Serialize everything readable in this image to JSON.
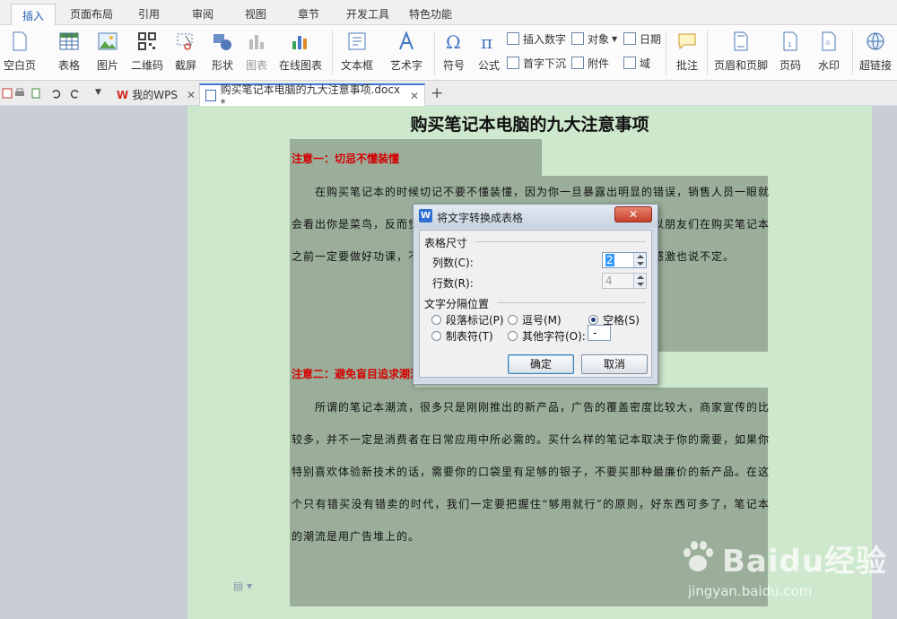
{
  "menu": {
    "tabs": [
      "插入",
      "页面布局",
      "引用",
      "审阅",
      "视图",
      "章节",
      "开发工具",
      "特色功能"
    ],
    "active": "插入"
  },
  "ribbon": {
    "blank_page": "空白页",
    "table": "表格",
    "image": "图片",
    "qrcode": "二维码",
    "screenshot": "截屏",
    "shape": "形状",
    "chart": "图表",
    "online_chart": "在线图表",
    "textbox": "文本框",
    "wordart": "艺术字",
    "symbol": "符号",
    "formula": "公式",
    "insert_number": "插入数字",
    "object": "对象",
    "date": "日期",
    "drop_cap": "首字下沉",
    "attachment": "附件",
    "field": "域",
    "comment": "批注",
    "header_footer": "页眉和页脚",
    "page_number": "页码",
    "watermark": "水印",
    "hyperlink": "超链接"
  },
  "tabs": {
    "wps_home": "我的WPS",
    "document": "购买笔记本电脑的九大注意事项.docx *"
  },
  "document": {
    "title": "购买笔记本电脑的九大注意事项",
    "heading1": "注意一：切忌不懂装懂",
    "para1": "在购买笔记本的时候切记不要不懂装懂，因为你一旦暴露出明显的错误，销售人员一眼就会看出你是菜鸟，反而觉得有利可图，有可能会把你当作宰的对象。所以朋友们在购买笔记本之前一定要做好功课，不懂的就多问，即便被瞒了也许还对经销商心存感激也说不定。",
    "heading2": "注意二：避免盲目追求潮流",
    "para2": "所谓的笔记本潮流，很多只是刚刚推出的新产品，广告的覆盖密度比较大，商家宣传的比较多，并不一定是消费者在日常应用中所必需的。买什么样的笔记本取决于你的需要，如果你特别喜欢体验新技术的话，需要你的口袋里有足够的银子，不要买那种最廉价的新产品。在这个只有错买没有错卖的时代，我们一定要把握住“够用就行”的原则，好东西可多了，笔记本的潮流是用广告堆上的。"
  },
  "dialog": {
    "title": "将文字转换成表格",
    "close": "✕",
    "size_group": "表格尺寸",
    "columns_label": "列数(C):",
    "columns_value": "2",
    "rows_label": "行数(R):",
    "rows_value": "4",
    "sep_group": "文字分隔位置",
    "opt_paragraph": "段落标记(P)",
    "opt_comma": "逗号(M)",
    "opt_space": "空格(S)",
    "opt_tab": "制表符(T)",
    "opt_other": "其他字符(O):",
    "other_value": "-",
    "selected": "空格(S)",
    "ok": "确定",
    "cancel": "取消"
  },
  "watermark": {
    "brand": "Baidu经验",
    "url": "jingyan.baidu.com"
  }
}
